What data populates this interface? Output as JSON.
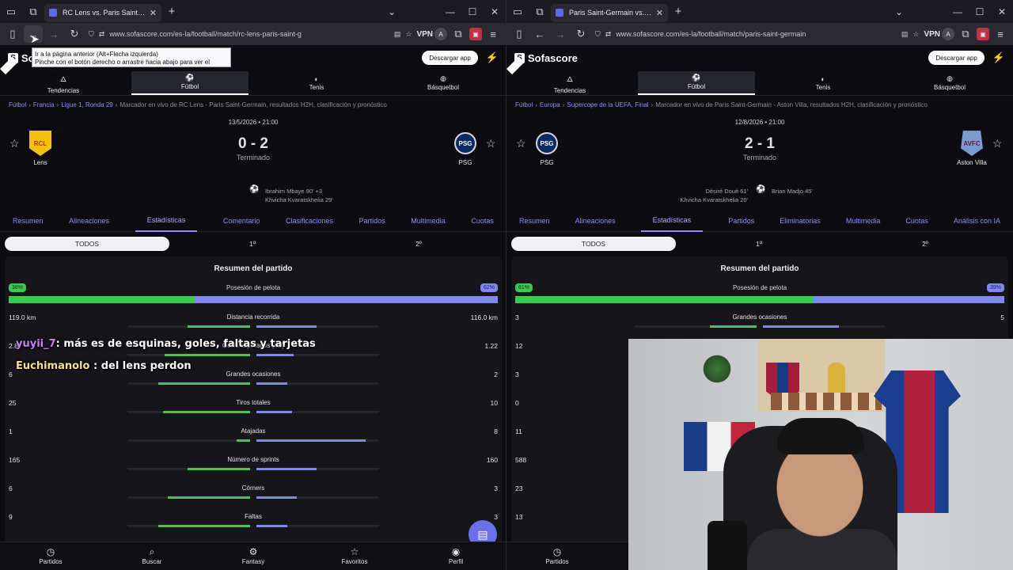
{
  "left": {
    "tab_title": "RC Lens vs. Paris Saint-Germain",
    "url": "www.sofascore.com/es-la/football/match/rc-lens-paris-saint-g",
    "vpn": "VPN",
    "brand": "Sofascore",
    "download": "Descargar app",
    "sports": [
      "Tendencias",
      "Fútbol",
      "Tenis",
      "Básquetbol"
    ],
    "breadcrumb": {
      "a": "Fútbol",
      "b": "Francia",
      "c": "Ligue 1, Ronda 29",
      "rest": "Marcador en vivo de RC Lens - Paris Saint-Germain, resultados H2H, clasificación y pronóstico"
    },
    "date": "13/5/2026 • 21:00",
    "home": "Lens",
    "home_badge": "RCL",
    "away": "PSG",
    "away_badge": "PSG",
    "score": "0 - 2",
    "status": "Terminado",
    "goals": [
      "Ibrahim Mbaye 90' +3",
      "Khvicha Kvaratskhelia 29'"
    ],
    "tabs": [
      "Resumen",
      "Alineaciones",
      "Estadísticas",
      "Comentario",
      "Clasificaciones",
      "Partidos",
      "Multimedia",
      "Cuotas"
    ],
    "periods": [
      "TODOS",
      "1º",
      "2º"
    ],
    "card_title": "Resumen del partido",
    "possession": {
      "label": "Posesión de pelota",
      "home": "38%",
      "away": "62%",
      "home_frac": 0.38
    },
    "stats": [
      {
        "label": "Distancia recorrida",
        "home": "119.0 km",
        "away": "116.0 km",
        "h": 0.51,
        "a": 0.49
      },
      {
        "label": "Goles esperados (xG)",
        "home": "2.87",
        "away": "1.22",
        "h": 0.7,
        "a": 0.3
      },
      {
        "label": "Grandes ocasiones",
        "home": "6",
        "away": "2",
        "h": 0.75,
        "a": 0.25
      },
      {
        "label": "Tiros totales",
        "home": "25",
        "away": "10",
        "h": 0.71,
        "a": 0.29
      },
      {
        "label": "Atajadas",
        "home": "1",
        "away": "8",
        "h": 0.11,
        "a": 0.89
      },
      {
        "label": "Número de sprints",
        "home": "165",
        "away": "160",
        "h": 0.51,
        "a": 0.49
      },
      {
        "label": "Córners",
        "home": "6",
        "away": "3",
        "h": 0.67,
        "a": 0.33
      },
      {
        "label": "Faltas",
        "home": "9",
        "away": "3",
        "h": 0.75,
        "a": 0.25
      }
    ],
    "tooltip": [
      "Ir a la página anterior (Alt+Flecha izquierda)",
      "Pinche con el botón derecho o arrastre hacia abajo para ver el historial"
    ],
    "nav": [
      "Partidos",
      "Buscar",
      "Fantasy",
      "Favoritos",
      "Perfil"
    ]
  },
  "right": {
    "tab_title": "Paris Saint-Germain vs. Aston V",
    "url": "www.sofascore.com/es-la/football/match/paris-saint-germain",
    "vpn": "VPN",
    "brand": "Sofascore",
    "download": "Descargar app",
    "sports": [
      "Tendencias",
      "Fútbol",
      "Tenis",
      "Básquetbol"
    ],
    "breadcrumb": {
      "a": "Fútbol",
      "b": "Europa",
      "c": "Supercope de la UEFA, Final",
      "rest": "Marcador en vivo de Paris Saint-Germain - Aston Villa, resultados H2H, clasificación y pronóstico"
    },
    "date": "12/8/2026 • 21:00",
    "home": "PSG",
    "home_badge": "PSG",
    "away": "Aston Villa",
    "away_badge": "AVFC",
    "score": "2 - 1",
    "status": "Terminado",
    "goals_home": [
      "Désiré Doué 61'",
      "Khvicha Kvaratskhelia 20'"
    ],
    "goals_away": [
      "Brian Madjo 45'"
    ],
    "tabs": [
      "Resumen",
      "Alineaciones",
      "Estadísticas",
      "Partidos",
      "Eliminatorias",
      "Multimedia",
      "Cuotas",
      "Análisis con IA"
    ],
    "periods": [
      "TODOS",
      "1º",
      "2º"
    ],
    "card_title": "Resumen del partido",
    "possession": {
      "label": "Posesión de pelota",
      "home": "61%",
      "away": "39%",
      "home_frac": 0.61
    },
    "stats": [
      {
        "label": "Grandes ocasiones",
        "home": "3",
        "away": "5",
        "h": 0.38,
        "a": 0.62
      },
      {
        "label": "",
        "home": "12",
        "away": "",
        "h": 0,
        "a": 0
      },
      {
        "label": "",
        "home": "3",
        "away": "",
        "h": 0,
        "a": 0
      },
      {
        "label": "",
        "home": "0",
        "away": "",
        "h": 0,
        "a": 0
      },
      {
        "label": "",
        "home": "11",
        "away": "",
        "h": 0,
        "a": 0
      },
      {
        "label": "",
        "home": "588",
        "away": "",
        "h": 0,
        "a": 0
      },
      {
        "label": "",
        "home": "23",
        "away": "",
        "h": 0,
        "a": 0
      },
      {
        "label": "",
        "home": "13",
        "away": "",
        "h": 0,
        "a": 0
      }
    ],
    "nav": [
      "Partidos"
    ]
  },
  "chat": [
    {
      "user": "yuyii_7",
      "msg": ": más es de esquinas, goles, faltas y tarjetas"
    },
    {
      "user": "Euchimanolo",
      "msg": " : del lens perdon"
    }
  ]
}
